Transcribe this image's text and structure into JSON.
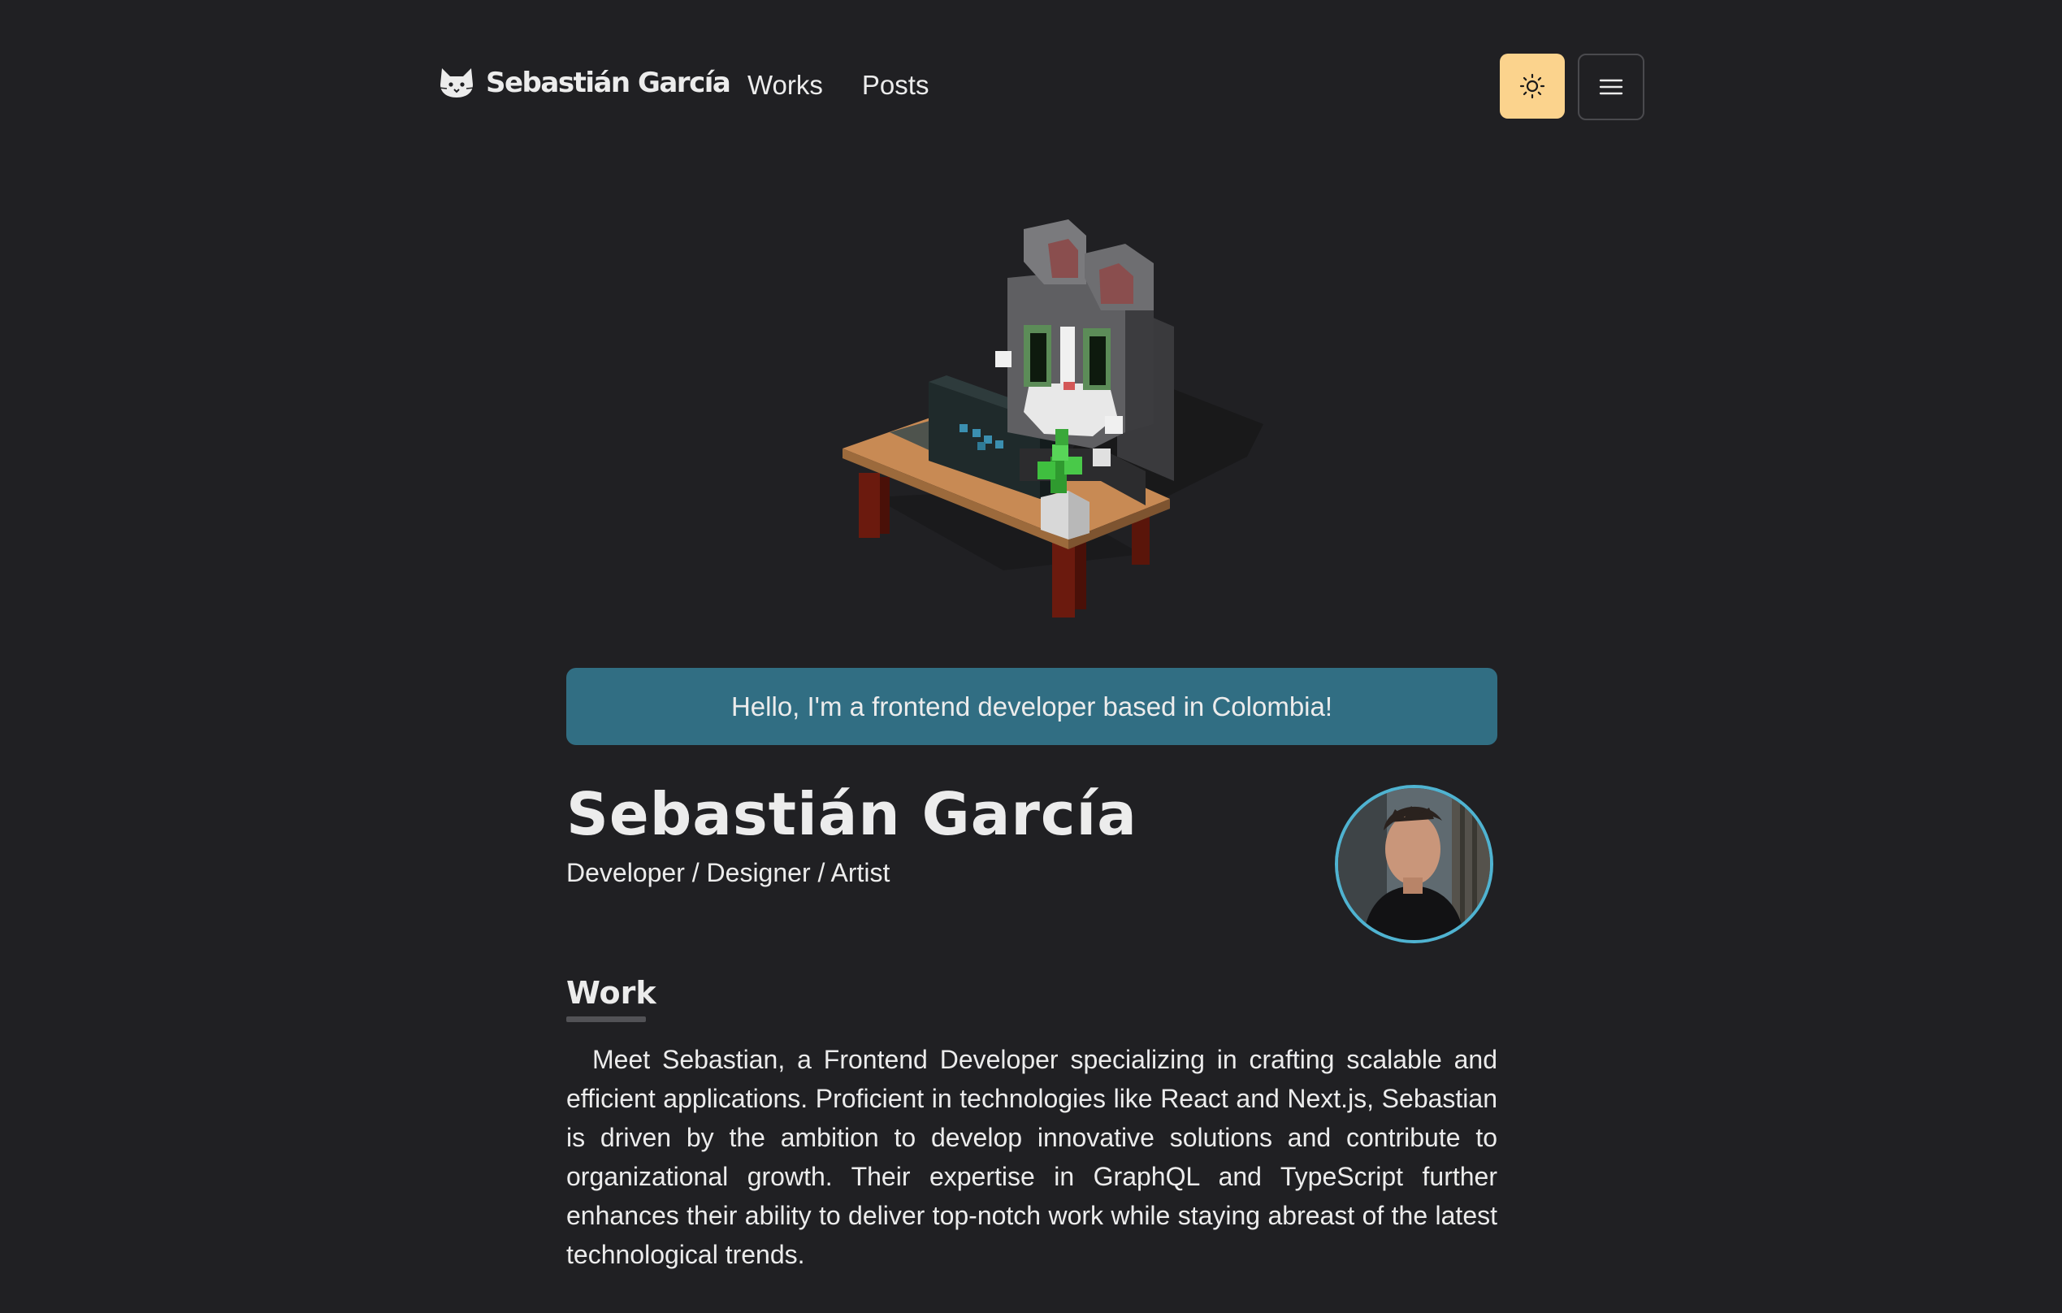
{
  "nav": {
    "brand": "Sebastián García",
    "links": [
      "Works",
      "Posts"
    ],
    "theme_icon": "sun-icon",
    "menu_icon": "hamburger-icon"
  },
  "banner": {
    "text": "Hello, I'm a frontend developer based in Colombia!"
  },
  "profile": {
    "name": "Sebastián García",
    "role": "Developer / Designer / Artist"
  },
  "work": {
    "title": "Work",
    "body": "Meet Sebastian, a Frontend Developer specializing in crafting scalable and efficient applications. Proficient in technologies like React and Next.js, Sebastian is driven by the ambition to develop innovative solutions and con­tribute to organizational growth. Their expertise in GraphQL and TypeScript further enhances their ability to deliver top-notch work while staying abreast of the latest technological trends."
  },
  "colors": {
    "background": "#202023",
    "banner": "#316e83",
    "theme_button": "#fbd38d",
    "avatar_border": "#4fb3d1"
  }
}
